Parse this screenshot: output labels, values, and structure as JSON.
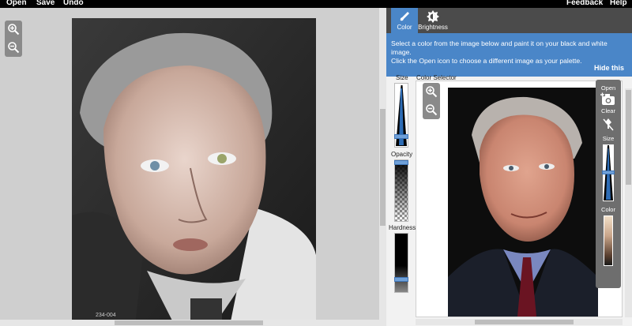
{
  "menu": {
    "open": "Open",
    "save": "Save",
    "undo": "Undo",
    "feedback": "Feedback",
    "help": "Help"
  },
  "tabs": {
    "color": "Color",
    "brightness": "Brightness"
  },
  "banner": {
    "line1": "Select a color from the image below and paint it on your black and white image.",
    "line2": "Click the Open icon to choose a different image as your palette.",
    "hide": "Hide this"
  },
  "labels": {
    "size": "Size",
    "opacity": "Opacity",
    "hardness": "Hardness",
    "color_selector": "Color Selector"
  },
  "tools": {
    "open": "Open",
    "clear": "Clear",
    "size": "Size",
    "color": "Color"
  },
  "colors": {
    "accent": "#4a86c8",
    "topbar": "#000000"
  }
}
